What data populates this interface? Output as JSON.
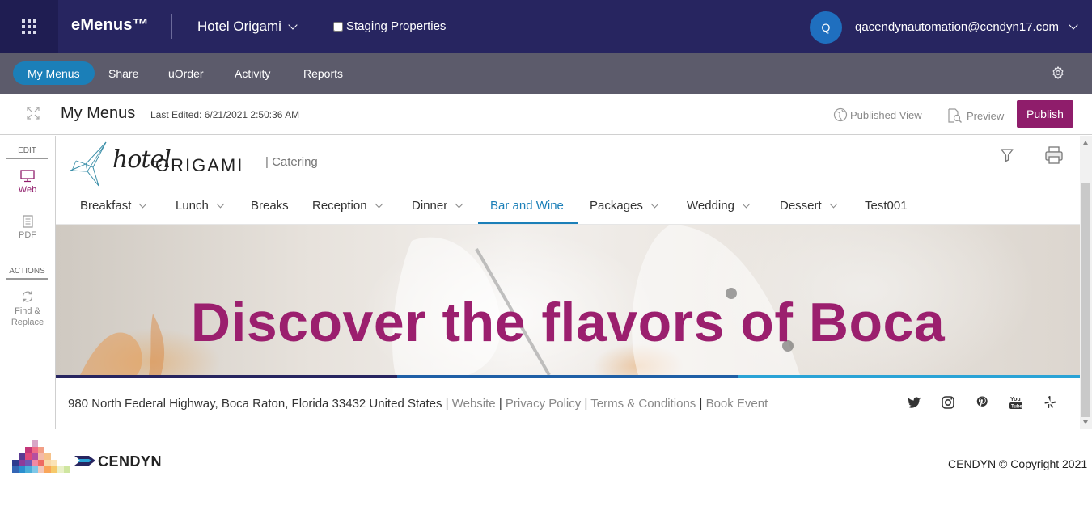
{
  "app": {
    "brand": "eMenus™",
    "property": "Hotel Origami",
    "staging_label": "Staging Properties",
    "avatar_initial": "Q",
    "user_email": "qacendynautomation@cendyn17.com"
  },
  "nav": {
    "items": [
      {
        "label": "My Menus",
        "active": true
      },
      {
        "label": "Share"
      },
      {
        "label": "uOrder"
      },
      {
        "label": "Activity"
      },
      {
        "label": "Reports"
      }
    ]
  },
  "page": {
    "title": "My Menus",
    "last_edited": "Last Edited: 6/21/2021 2:50:36 AM",
    "published_view": "Published View",
    "preview": "Preview",
    "publish": "Publish"
  },
  "rail": {
    "edit_heading": "EDIT",
    "web_label": "Web",
    "pdf_label": "PDF",
    "actions_heading": "ACTIONS",
    "find_replace_line1": "Find &",
    "find_replace_line2": "Replace"
  },
  "menu": {
    "logo_hotel": "hotel",
    "logo_origami": "ORIGAMI",
    "subtitle": "| Catering",
    "tabs": [
      {
        "label": "Breakfast",
        "dropdown": true
      },
      {
        "label": "Lunch",
        "dropdown": true
      },
      {
        "label": "Breaks",
        "dropdown": false
      },
      {
        "label": "Reception",
        "dropdown": true
      },
      {
        "label": "Dinner",
        "dropdown": true
      },
      {
        "label": "Bar and Wine",
        "dropdown": false,
        "active": true
      },
      {
        "label": "Packages",
        "dropdown": true
      },
      {
        "label": "Wedding",
        "dropdown": true
      },
      {
        "label": "Dessert",
        "dropdown": true
      },
      {
        "label": "Test001",
        "dropdown": false
      }
    ],
    "hero_title": "Discover the flavors of Boca",
    "address": "980 North Federal Highway, Boca Raton, Florida 33432 United States",
    "separator": "|",
    "links": {
      "website": "Website",
      "privacy": "Privacy Policy",
      "terms": "Terms & Conditions",
      "book": "Book Event"
    },
    "social_icons": [
      "twitter-icon",
      "instagram-icon",
      "pinterest-icon",
      "youtube-icon",
      "yelp-icon"
    ]
  },
  "footer": {
    "company": "CENDYN",
    "copyright": "CENDYN © Copyright 2021"
  },
  "colors": {
    "top_bar": "#272560",
    "nav_bar": "#5c5b6b",
    "accent_blue": "#1b7fb8",
    "publish": "#8f1d6b",
    "hero_text": "#9b1f6e"
  }
}
